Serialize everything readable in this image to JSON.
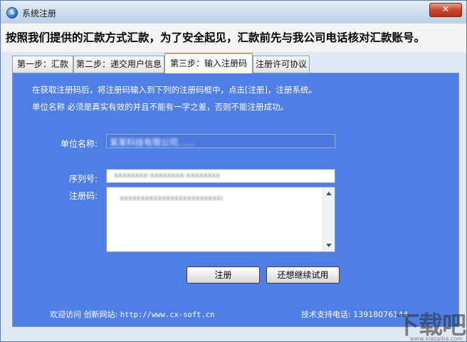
{
  "window": {
    "title": "系统注册",
    "close_label": "✕",
    "app_icon_letter": "S"
  },
  "notice": "按照我们提供的汇款方式汇款，为了安全起见，汇款前先与我公司电话核对汇款账号。",
  "tabs": [
    {
      "label": "第一步：汇款",
      "active": false
    },
    {
      "label": "第二步：递交用户信息",
      "active": false
    },
    {
      "label": "第三步：输入注册码",
      "active": true
    },
    {
      "label": "注册许可协议",
      "active": false
    }
  ],
  "panel": {
    "intro_line1": "在获取注册码后，将注册码输入到下列的注册码框中，点击[注册]，注册系统。",
    "intro_line2": "单位名称 必须是真实有效的并且不能有一字之差，否则不能注册成功。",
    "unit_label": "单位名称:",
    "unit_value": "某某科技有限公司……",
    "serial_label": "序列号:",
    "serial_value": "xxxxxxxx-xxxxxxxx-xxxxxxxx",
    "code_label": "注册码:",
    "code_value": "xxxxxxxxxxxxxxxxxxxxxxxxxxxxxxxxxxxxxx",
    "register_button": "注册",
    "trial_button": "还想继续试用",
    "footer_visit": "欢迎访问 创新网站: ",
    "footer_url": "http://www.cx-soft.cn",
    "footer_support": "技术支持电话: 13918076144"
  },
  "watermark": {
    "text": "下载吧",
    "url": "www.xiazaiba.com"
  }
}
